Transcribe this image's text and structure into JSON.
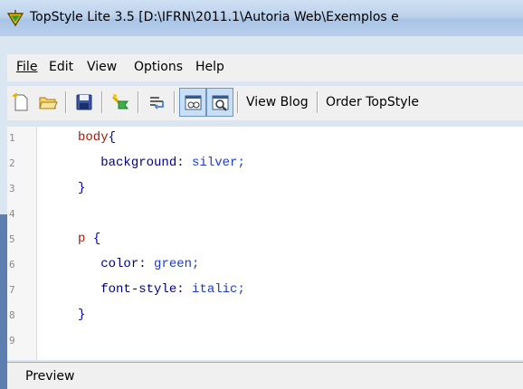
{
  "window": {
    "title": "TopStyle Lite 3.5 [D:\\IFRN\\2011.1\\Autoria Web\\Exemplos e"
  },
  "menu": {
    "file": "File",
    "edit": "Edit",
    "view": "View",
    "options": "Options",
    "help": "Help"
  },
  "toolbar": {
    "view_blog": "View Blog",
    "order": "Order TopStyle"
  },
  "editor": {
    "line_numbers": [
      "1",
      "2",
      "3",
      "4",
      "5",
      "6",
      "7",
      "8",
      "9"
    ],
    "code": {
      "body_selector": "body",
      "brace_open": "{",
      "brace_close": "}",
      "prop_background": "background:",
      "val_silver": "silver;",
      "p_selector": "p",
      "prop_color": "color:",
      "val_green": "green;",
      "prop_font_style": "font-style:",
      "val_italic": "italic;"
    }
  },
  "preview": {
    "label": "Preview"
  }
}
